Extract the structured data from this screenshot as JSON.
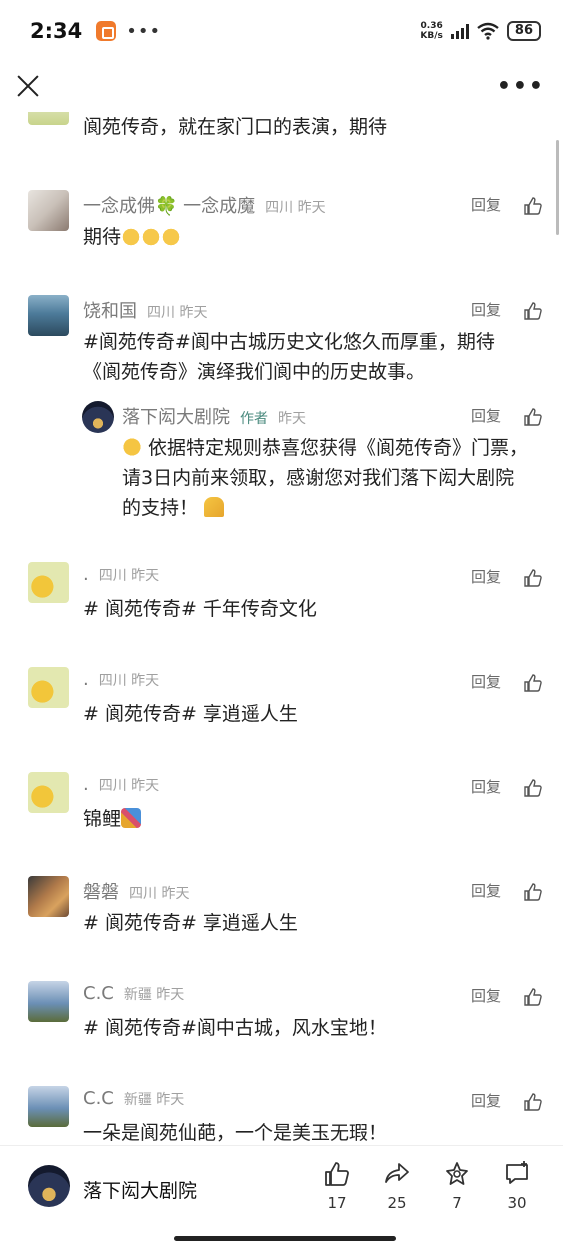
{
  "status": {
    "time": "2:34",
    "speed_top": "0.36",
    "speed_bottom": "KB/s",
    "hd": "HD",
    "battery": "86"
  },
  "comments": [
    {
      "text": "阆苑传奇，就在家门口的表演，期待"
    },
    {
      "name": "一念成佛🍀 一念成魔",
      "meta": "四川  昨天",
      "reply": "回复",
      "text": "期待"
    },
    {
      "name": "饶和国",
      "meta": "四川  昨天",
      "reply": "回复",
      "text": "#阆苑传奇#阆中古城历史文化悠久而厚重，期待《阆苑传奇》演绎我们阆中的历史故事。"
    },
    {
      "name": "落下闳大剧院",
      "author": "作者",
      "meta": "昨天",
      "reply": "回复",
      "text": "依据特定规则恭喜您获得《阆苑传奇》门票，请3日内前来领取，感谢您对我们落下闳大剧院的支持！"
    },
    {
      "name": ".",
      "meta": "四川  昨天",
      "reply": "回复",
      "text": "# 阆苑传奇# 千年传奇文化"
    },
    {
      "name": ".",
      "meta": "四川  昨天",
      "reply": "回复",
      "text": "# 阆苑传奇# 享逍遥人生"
    },
    {
      "name": ".",
      "meta": "四川  昨天",
      "reply": "回复",
      "text": "锦鲤"
    },
    {
      "name": "磐磐",
      "meta": "四川  昨天",
      "reply": "回复",
      "text": "# 阆苑传奇# 享逍遥人生"
    },
    {
      "name": "C.C",
      "meta": "新疆  昨天",
      "reply": "回复",
      "text": "# 阆苑传奇#阆中古城，风水宝地！"
    },
    {
      "name": "C.C",
      "meta": "新疆  昨天",
      "reply": "回复",
      "text": "一朵是阆苑仙葩，一个是美玉无瑕！"
    }
  ],
  "bottom": {
    "account_name": "落下闳大剧院",
    "likes": "17",
    "shares": "25",
    "favorites": "7",
    "comments": "30"
  }
}
